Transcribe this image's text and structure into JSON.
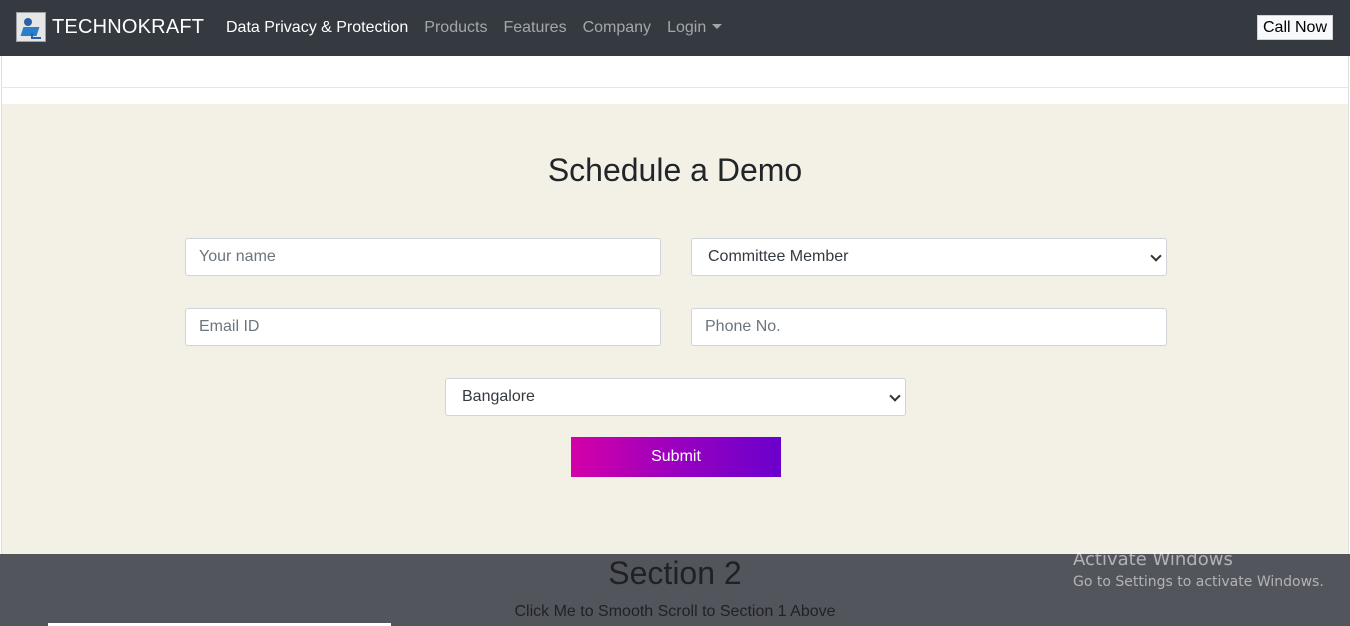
{
  "navbar": {
    "brand": "TECHNOKRAFT",
    "links": [
      {
        "label": "Data Privacy & Protection",
        "active": true
      },
      {
        "label": "Products",
        "active": false
      },
      {
        "label": "Features",
        "active": false
      },
      {
        "label": "Company",
        "active": false
      },
      {
        "label": "Login",
        "active": false,
        "dropdown": true
      }
    ],
    "call_button": "Call Now"
  },
  "demo_form": {
    "title": "Schedule a Demo",
    "name_placeholder": "Your name",
    "role_selected": "Committee Member",
    "email_placeholder": "Email ID",
    "phone_placeholder": "Phone No.",
    "city_selected": "Bangalore",
    "submit_label": "Submit",
    "background_color": "#f3f0e6"
  },
  "section_2": {
    "title": "Section 2",
    "scroll_link": "Click Me to Smooth Scroll to Section 1 Above",
    "background_color": "#53555c"
  },
  "windows_watermark": {
    "line1": "Activate Windows",
    "line2": "Go to Settings to activate Windows."
  },
  "colors": {
    "navbar": "#343a40",
    "submit_gradient_start": "#d400a8",
    "submit_gradient_end": "#6a00cc"
  }
}
